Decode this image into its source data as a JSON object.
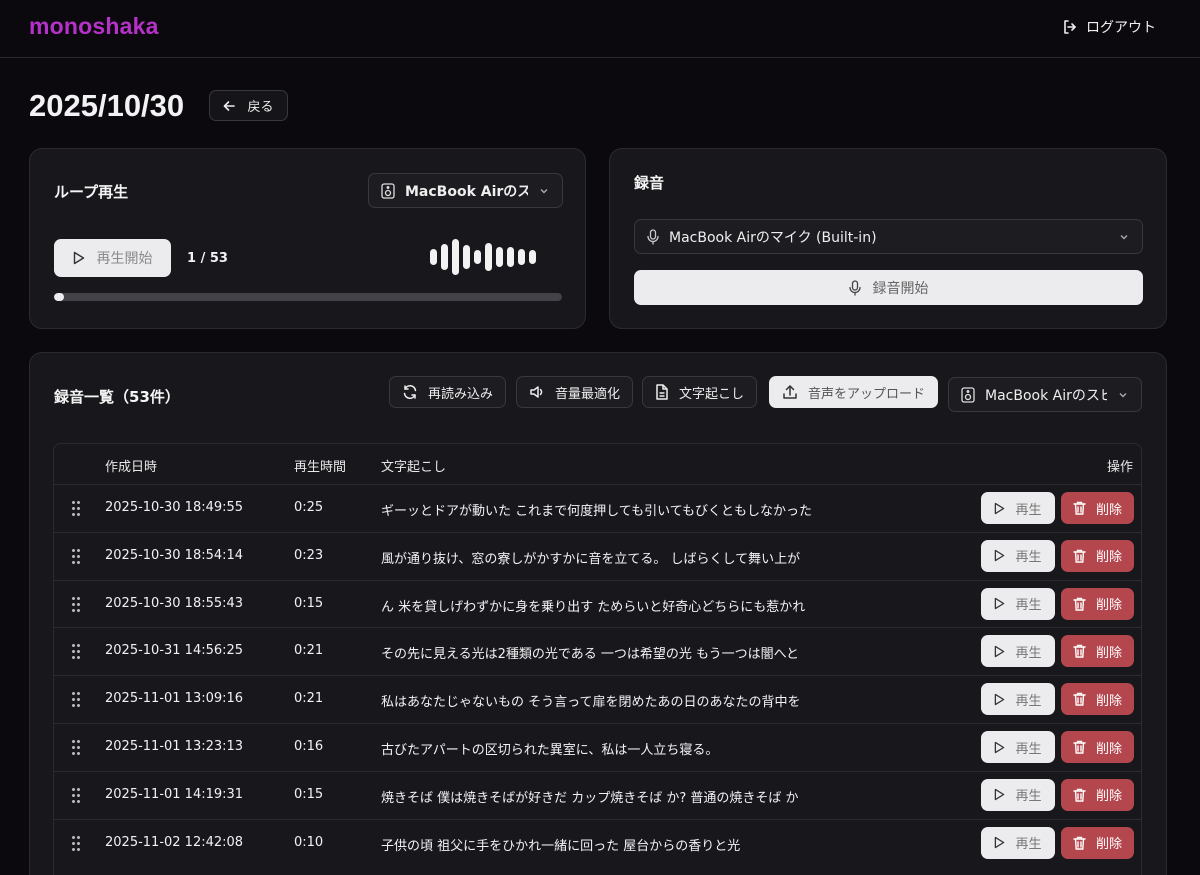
{
  "app": {
    "logo": "monoshaka",
    "logout_label": "ログアウト"
  },
  "page": {
    "title": "2025/10/30",
    "back_label": "戻る"
  },
  "loop": {
    "title": "ループ再生",
    "output_device": "MacBook Airのスピーカー",
    "play_label": "再生開始",
    "counter": "1 / 53",
    "progress": 0.02
  },
  "record": {
    "title": "録音",
    "input_device": "MacBook Airのマイク (Built-in)",
    "start_label": "録音開始"
  },
  "list": {
    "title": "録音一覧（53件）",
    "reload_label": "再読み込み",
    "normalize_label": "音量最適化",
    "transcribe_label": "文字起こし",
    "upload_label": "音声をアップロード",
    "output_device": "MacBook Airのスピーカー",
    "columns": {
      "created": "作成日時",
      "duration": "再生時間",
      "transcript": "文字起こし",
      "actions": "操作"
    },
    "play_label": "再生",
    "delete_label": "削除",
    "rows": [
      {
        "created": "2025-10-30 18:49:55",
        "duration": "0:25",
        "transcript": "ギーッとドアが動いた これまで何度押しても引いてもびくともしなかった"
      },
      {
        "created": "2025-10-30 18:54:14",
        "duration": "0:23",
        "transcript": "風が通り抜け、窓の寮しがかすかに音を立てる。 しばらくして舞い上が"
      },
      {
        "created": "2025-10-30 18:55:43",
        "duration": "0:15",
        "transcript": "ん 米を貸しげわずかに身を乗り出す ためらいと好奇心どちらにも惹かれ"
      },
      {
        "created": "2025-10-31 14:56:25",
        "duration": "0:21",
        "transcript": "その先に見える光は2種類の光である 一つは希望の光 もう一つは闇へと"
      },
      {
        "created": "2025-11-01 13:09:16",
        "duration": "0:21",
        "transcript": "私はあなたじゃないもの そう言って扉を閉めたあの日のあなたの背中を"
      },
      {
        "created": "2025-11-01 13:23:13",
        "duration": "0:16",
        "transcript": "古びたアパートの区切られた異室に、私は一人立ち寝る。"
      },
      {
        "created": "2025-11-01 14:19:31",
        "duration": "0:15",
        "transcript": "焼きそば 僕は焼きそばが好きだ カップ焼きそば か? 普通の焼きそば か"
      },
      {
        "created": "2025-11-02 12:42:08",
        "duration": "0:10",
        "transcript": "子供の頃 祖父に手をひかれ一緒に回った 屋台からの香りと光"
      }
    ]
  },
  "colors": {
    "logo": "#b631c9",
    "danger": "#b4474d",
    "light_button": "#ececee"
  }
}
